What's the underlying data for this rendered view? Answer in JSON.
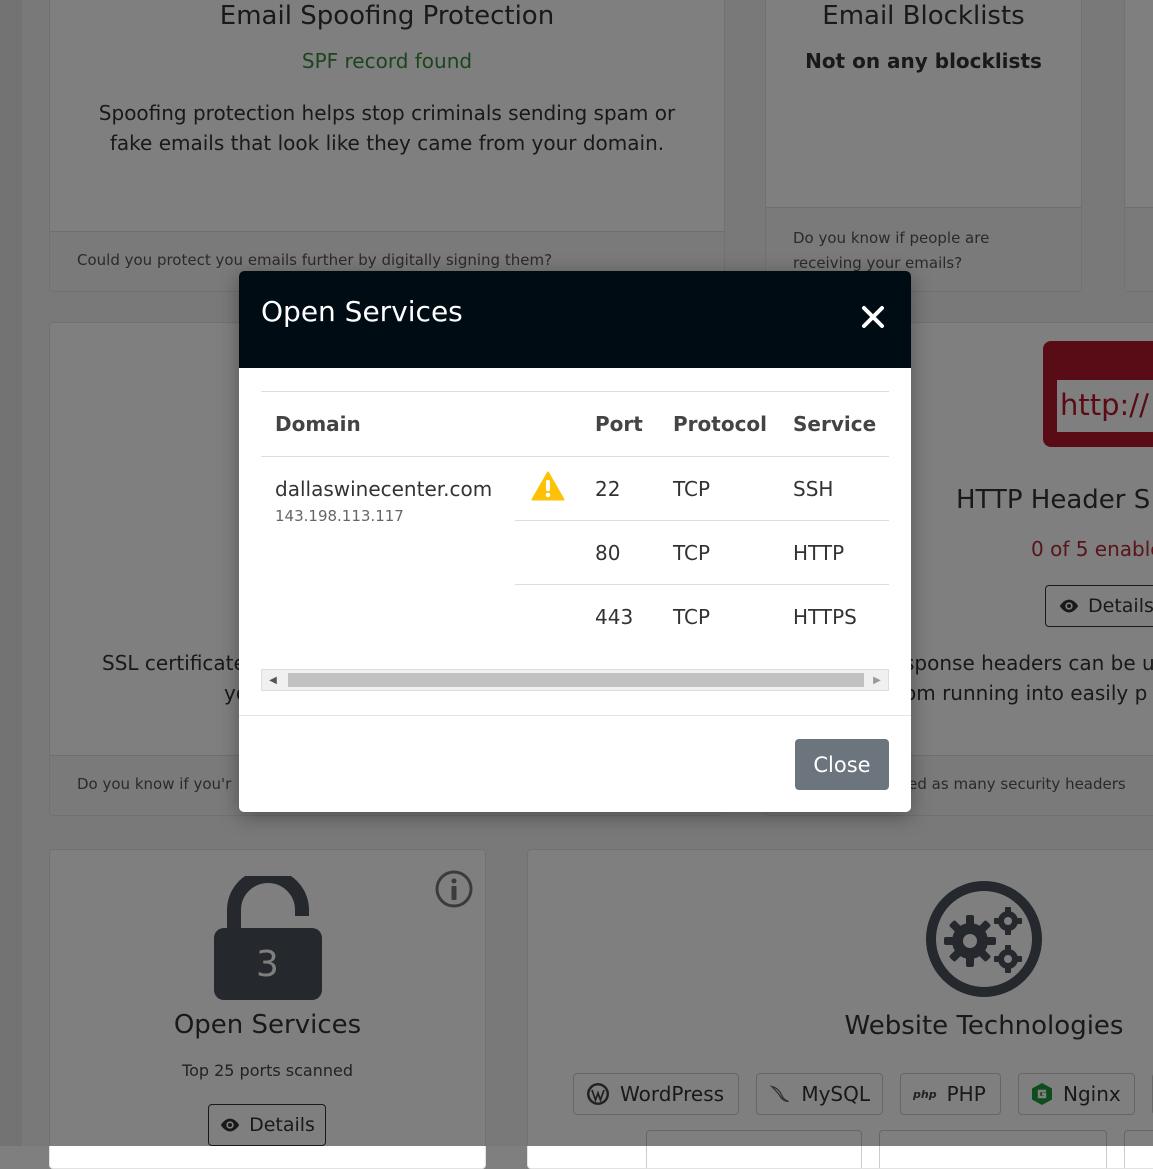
{
  "cards": {
    "spf": {
      "title": "Email Spoofing Protection",
      "status": "SPF record found",
      "description": "Spoofing protection helps stop criminals sending spam or fake emails that look like they came from your domain.",
      "footer": "Could you protect you emails further by digitally signing them?"
    },
    "blocklist": {
      "title": "Email Blocklists",
      "status": "Not on any blocklists",
      "footer": "Do you know if people are receiving your emails?"
    },
    "ssl": {
      "description_partial": "SSL certificate",
      "description_partial_2": "yo",
      "footer_partial": "Do you know if you'r"
    },
    "http": {
      "badge": "http://",
      "title": "HTTP Header S",
      "status": "0 of 5 enable",
      "details_label": "Details",
      "description_partial": "sponse headers can be u",
      "description_partial_2": "om running into easily p",
      "footer_partial": "led as many security headers"
    },
    "open_services": {
      "count": "3",
      "title": "Open Services",
      "subtitle": "Top 25 ports scanned",
      "details_label": "Details"
    },
    "website_tech": {
      "title": "Website Technologies",
      "items": [
        "WordPress",
        "MySQL",
        "PHP",
        "Nginx"
      ]
    }
  },
  "modal": {
    "title": "Open Services",
    "columns": {
      "domain": "Domain",
      "port": "Port",
      "protocol": "Protocol",
      "service": "Service"
    },
    "domain": "dallaswinecenter.com",
    "ip": "143.198.113.117",
    "rows": [
      {
        "port": "22",
        "protocol": "TCP",
        "service": "SSH",
        "warning": true
      },
      {
        "port": "80",
        "protocol": "TCP",
        "service": "HTTP",
        "warning": false
      },
      {
        "port": "443",
        "protocol": "TCP",
        "service": "HTTPS",
        "warning": false
      }
    ],
    "close_label": "Close"
  },
  "colors": {
    "success": "#3a8a3a",
    "danger": "#b02a37",
    "warning": "#ffc107",
    "modal_header": "#000c14",
    "close_button": "#6c757d",
    "icon_gray": "#4a5158"
  }
}
